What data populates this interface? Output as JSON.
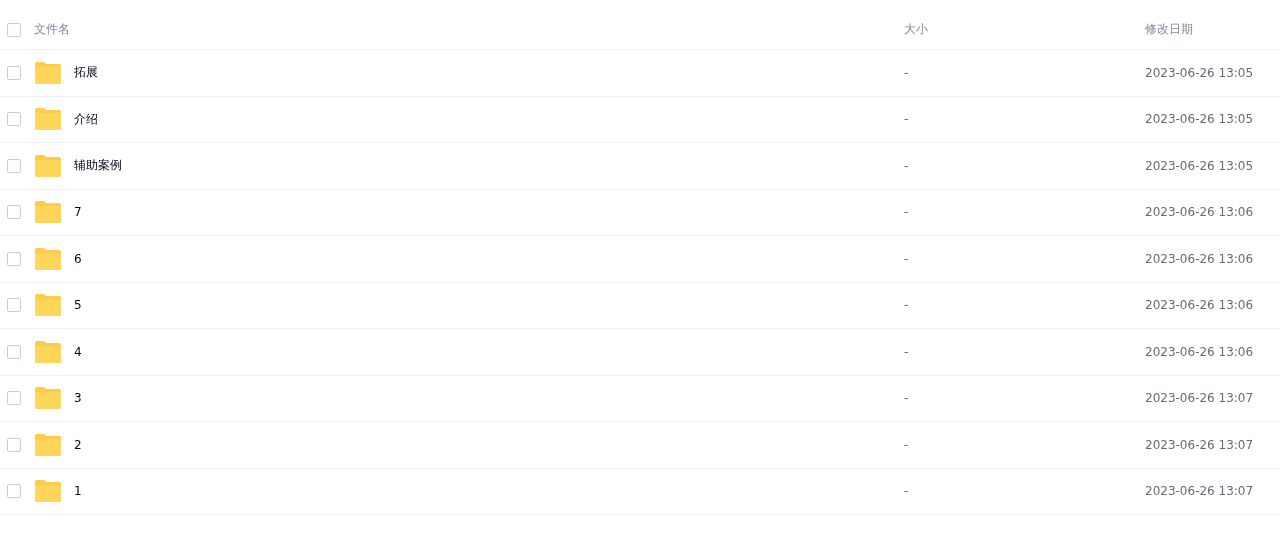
{
  "header": {
    "checked": false,
    "columns": [
      "文件名",
      "大小",
      "修改日期"
    ]
  },
  "rows": [
    {
      "name": "拓展",
      "size": "-",
      "modified": "2023-06-26 13:05",
      "checked": false
    },
    {
      "name": "介绍",
      "size": "-",
      "modified": "2023-06-26 13:05",
      "checked": false
    },
    {
      "name": "辅助案例",
      "size": "-",
      "modified": "2023-06-26 13:05",
      "checked": false
    },
    {
      "name": "7",
      "size": "-",
      "modified": "2023-06-26 13:06",
      "checked": false
    },
    {
      "name": "6",
      "size": "-",
      "modified": "2023-06-26 13:06",
      "checked": false
    },
    {
      "name": "5",
      "size": "-",
      "modified": "2023-06-26 13:06",
      "checked": false
    },
    {
      "name": "4",
      "size": "-",
      "modified": "2023-06-26 13:06",
      "checked": false
    },
    {
      "name": "3",
      "size": "-",
      "modified": "2023-06-26 13:07",
      "checked": false
    },
    {
      "name": "2",
      "size": "-",
      "modified": "2023-06-26 13:07",
      "checked": false
    },
    {
      "name": "1",
      "size": "-",
      "modified": "2023-06-26 13:07",
      "checked": false
    }
  ]
}
